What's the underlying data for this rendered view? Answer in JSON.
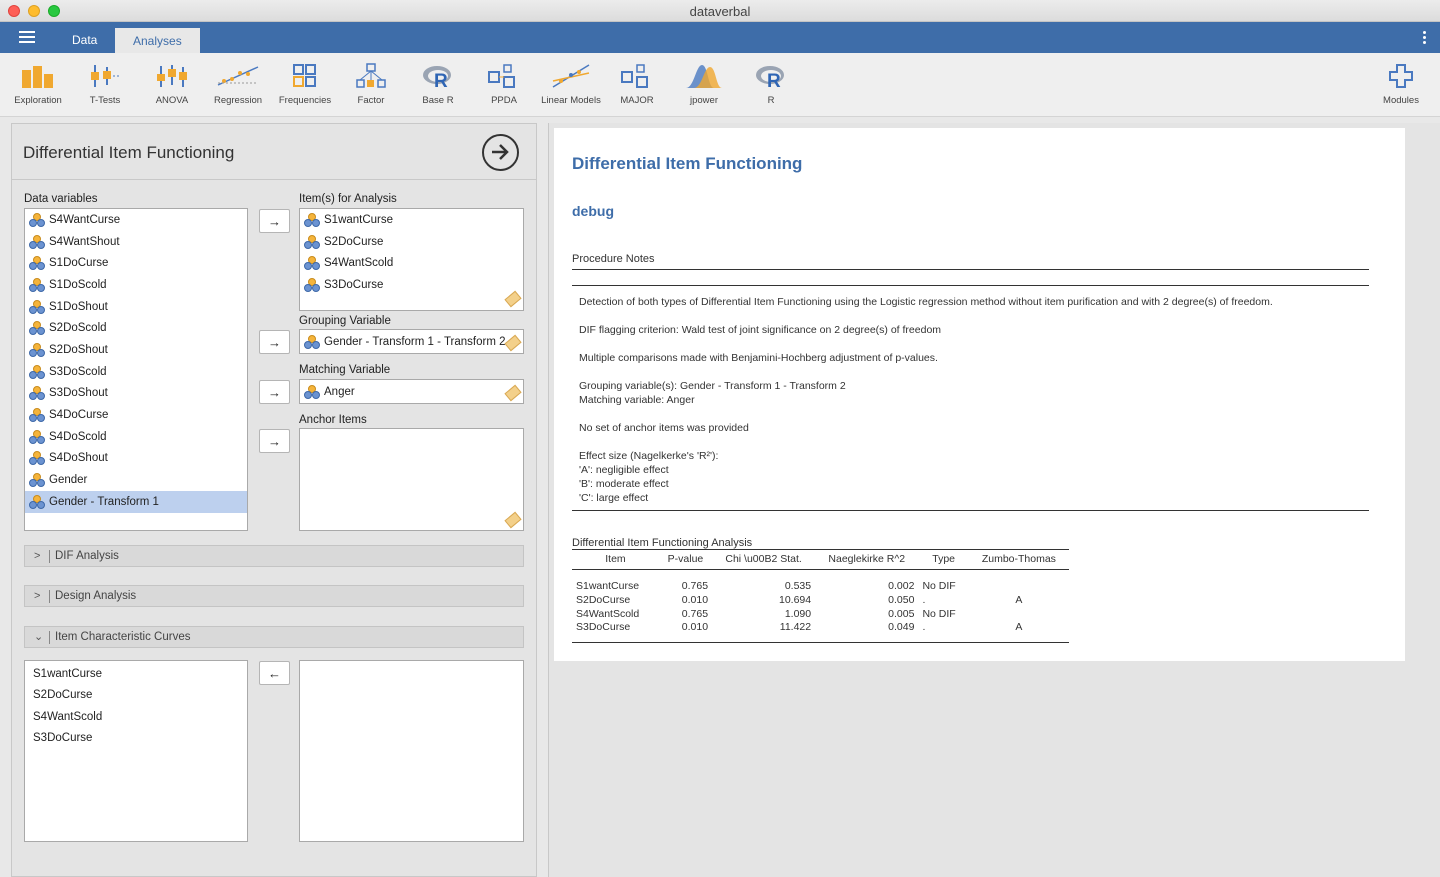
{
  "window": {
    "title": "dataverbal"
  },
  "nav": {
    "tabs": [
      "Data",
      "Analyses"
    ]
  },
  "toolbar": {
    "items": [
      "Exploration",
      "T-Tests",
      "ANOVA",
      "Regression",
      "Frequencies",
      "Factor",
      "Base R",
      "PPDA",
      "Linear Models",
      "MAJOR",
      "jpower",
      "R"
    ],
    "modules": "Modules"
  },
  "options": {
    "title": "Differential Item Functioning",
    "data_variables_label": "Data variables",
    "data_variables": [
      "S4WantCurse",
      "S4WantShout",
      "S1DoCurse",
      "S1DoScold",
      "S1DoShout",
      "S2DoScold",
      "S2DoShout",
      "S3DoScold",
      "S3DoShout",
      "S4DoCurse",
      "S4DoScold",
      "S4DoShout",
      "Gender",
      "Gender - Transform 1"
    ],
    "selected_variable": "Gender - Transform 1",
    "items_label": "Item(s) for Analysis",
    "items": [
      "S1wantCurse",
      "S2DoCurse",
      "S4WantScold",
      "S3DoCurse"
    ],
    "grouping_label": "Grouping Variable",
    "grouping_value": "Gender - Transform 1 - Transform 2",
    "matching_label": "Matching Variable",
    "matching_value": "Anger",
    "anchor_label": "Anchor Items",
    "sections": [
      "DIF Analysis",
      "Design Analysis",
      "Item Characteristic Curves"
    ],
    "icc_items": [
      "S1wantCurse",
      "S2DoCurse",
      "S4WantScold",
      "S3DoCurse"
    ]
  },
  "results": {
    "title": "Differential Item Functioning",
    "debug": "debug",
    "procedure_notes_label": "Procedure Notes",
    "notes": {
      "n1": "Detection of both types of Differential Item Functioning using the Logistic regression method without item purification and with 2 degree(s) of freedom.",
      "n2": "DIF flagging criterion: Wald test of joint significance on 2 degree(s) of freedom",
      "n3": "Multiple comparisons made with Benjamini-Hochberg adjustment of p-values.",
      "n4a": "Grouping variable(s): Gender - Transform 1 - Transform 2",
      "n4b": "Matching variable: Anger",
      "n5": "No set of anchor items was provided",
      "n6a": "Effect size (Nagelkerke's 'R²'):",
      "n6b": "'A': negligible effect",
      "n6c": "'B': moderate effect",
      "n6d": "'C': large effect"
    },
    "table_label": "Differential Item Functioning Analysis",
    "columns": [
      "Item",
      "P-value",
      "Chi \\u00B2 Stat.",
      "Naeglekirke R^2",
      "Type",
      "Zumbo-Thomas"
    ],
    "rows": [
      [
        "S1wantCurse",
        "0.765",
        "0.535",
        "0.002",
        "No DIF",
        ""
      ],
      [
        "S2DoCurse",
        "0.010",
        "10.694",
        "0.050",
        ".",
        "A"
      ],
      [
        "S4WantScold",
        "0.765",
        "1.090",
        "0.005",
        "No DIF",
        ""
      ],
      [
        "S3DoCurse",
        "0.010",
        "11.422",
        "0.049",
        ".",
        "A"
      ]
    ]
  }
}
